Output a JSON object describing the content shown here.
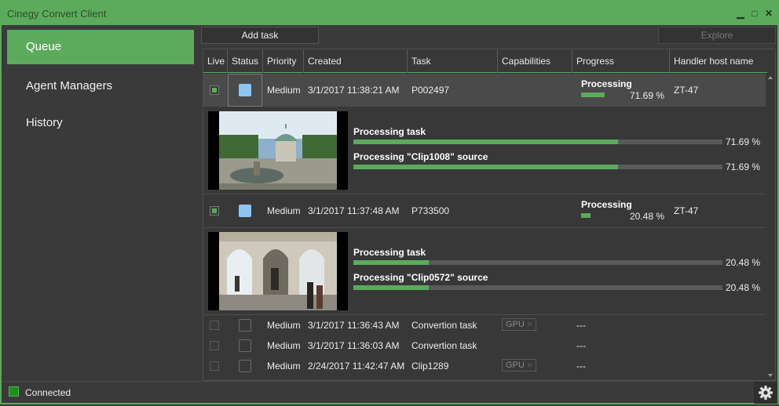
{
  "window": {
    "title": "Cinegy Convert Client",
    "controls": {
      "minimize": "▁",
      "maximize": "□",
      "close": "✕"
    }
  },
  "colors": {
    "accent": "#5cab5c",
    "status_blue": "#8fc3f2",
    "connected": "#1f8f1f"
  },
  "sidebar": {
    "items": [
      {
        "label": "Queue",
        "active": true
      },
      {
        "label": "Agent Managers",
        "active": false
      },
      {
        "label": "History",
        "active": false
      }
    ]
  },
  "toolbar": {
    "add_task": "Add task",
    "explore": "Explore"
  },
  "table": {
    "headers": [
      "Live",
      "Status",
      "Priority",
      "Created",
      "Task",
      "Capabilities",
      "Progress",
      "Handler host name"
    ]
  },
  "tasks": [
    {
      "priority": "Medium",
      "created": "3/1/2017 11:38:21 AM",
      "task": "P002497",
      "progress_label": "Processing",
      "progress_text": "71.69 %",
      "progress": 0.7169,
      "host": "ZT-47",
      "details": [
        {
          "label": "Processing task",
          "value": "71.69 %",
          "progress": 0.7169
        },
        {
          "label": "Processing \"Clip1008\" source",
          "value": "71.69 %",
          "progress": 0.7169
        }
      ]
    },
    {
      "priority": "Medium",
      "created": "3/1/2017 11:37:48 AM",
      "task": "P733500",
      "progress_label": "Processing",
      "progress_text": "20.48 %",
      "progress": 0.2048,
      "host": "ZT-47",
      "details": [
        {
          "label": "Processing task",
          "value": "20.48 %",
          "progress": 0.2048
        },
        {
          "label": "Processing \"Clip0572\" source",
          "value": "20.48 %",
          "progress": 0.2048
        }
      ]
    },
    {
      "priority": "Medium",
      "created": "3/1/2017 11:36:43 AM",
      "task": "Convertion task",
      "capability": "GPU",
      "host": "---"
    },
    {
      "priority": "Medium",
      "created": "3/1/2017 11:36:03 AM",
      "task": "Convertion task",
      "host": "---"
    },
    {
      "priority": "Medium",
      "created": "2/24/2017 11:42:47 AM",
      "task": "Clip1289",
      "capability": "GPU",
      "host": "---"
    }
  ],
  "statusbar": {
    "connection": "Connected"
  },
  "icons": [
    "settings-gear-icon",
    "scroll-up-icon",
    "scroll-down-icon"
  ]
}
